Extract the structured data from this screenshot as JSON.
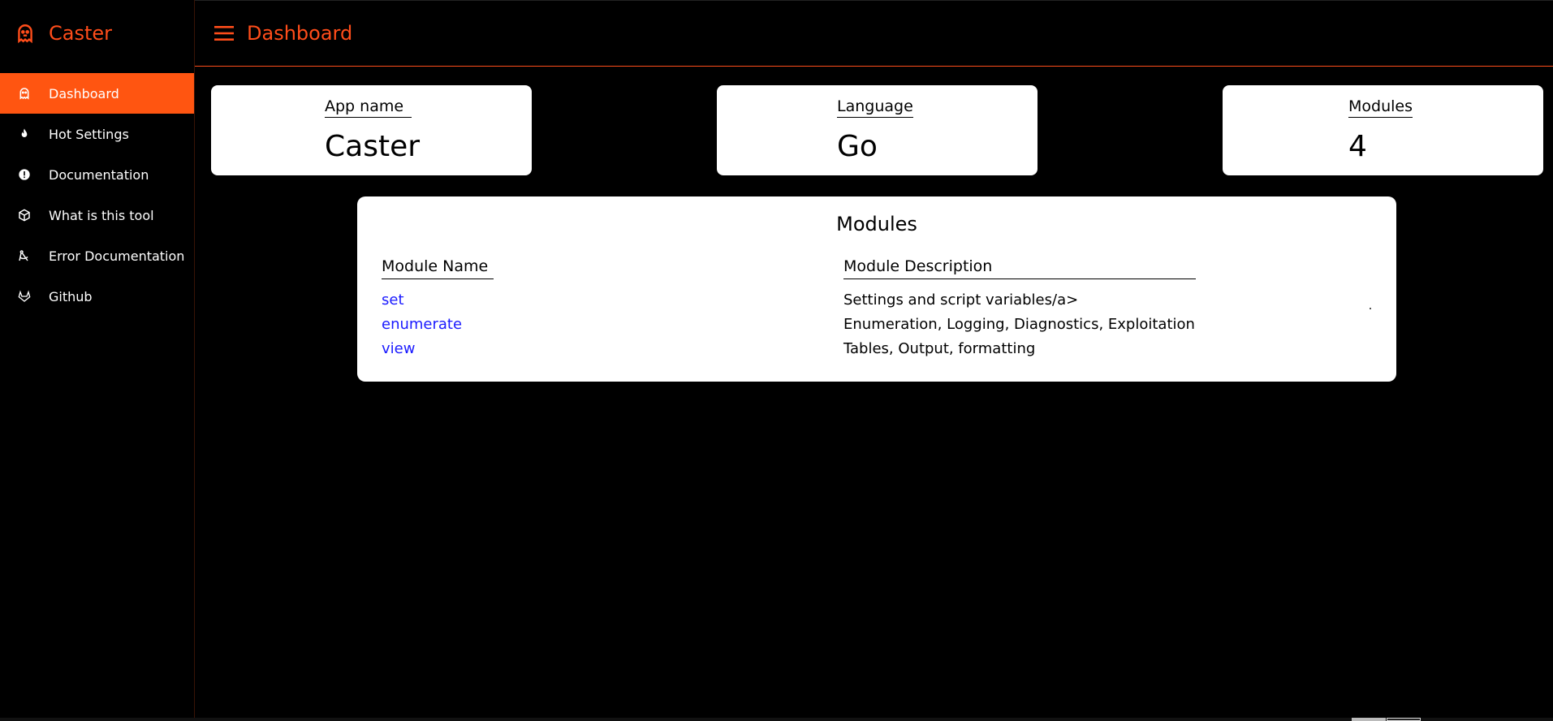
{
  "brand": {
    "title": "Caster",
    "icon": "ghost-icon"
  },
  "header": {
    "title": "Dashboard",
    "menu_icon": "menu-icon"
  },
  "sidebar": {
    "items": [
      {
        "label": "Dashboard",
        "icon": "ghost-icon",
        "active": true
      },
      {
        "label": "Hot Settings",
        "icon": "fire-icon",
        "active": false
      },
      {
        "label": "Documentation",
        "icon": "alert-circle-icon",
        "active": false
      },
      {
        "label": "What is this tool",
        "icon": "cube-icon",
        "active": false
      },
      {
        "label": "Error Documentation",
        "icon": "drafting-compass-icon",
        "active": false
      },
      {
        "label": "Github",
        "icon": "gitlab-icon",
        "active": false
      }
    ]
  },
  "cards": {
    "app_name": {
      "label": "App name",
      "value": "Caster"
    },
    "language": {
      "label": "Language",
      "value": "Go"
    },
    "modules": {
      "label": "Modules",
      "value": "4"
    }
  },
  "modules_panel": {
    "title": "Modules",
    "headers": {
      "name": "Module Name",
      "description": "Module Description"
    },
    "rows": [
      {
        "name": "set",
        "description": "Settings and script variables/a>"
      },
      {
        "name": "enumerate",
        "description": "Enumeration, Logging, Diagnostics, Exploitation"
      },
      {
        "name": "view",
        "description": "Tables, Output, formatting"
      }
    ]
  },
  "colors": {
    "accent": "#ff4d1a",
    "active_bg": "#ff5511",
    "link": "#1a1aff",
    "background": "#000000"
  }
}
